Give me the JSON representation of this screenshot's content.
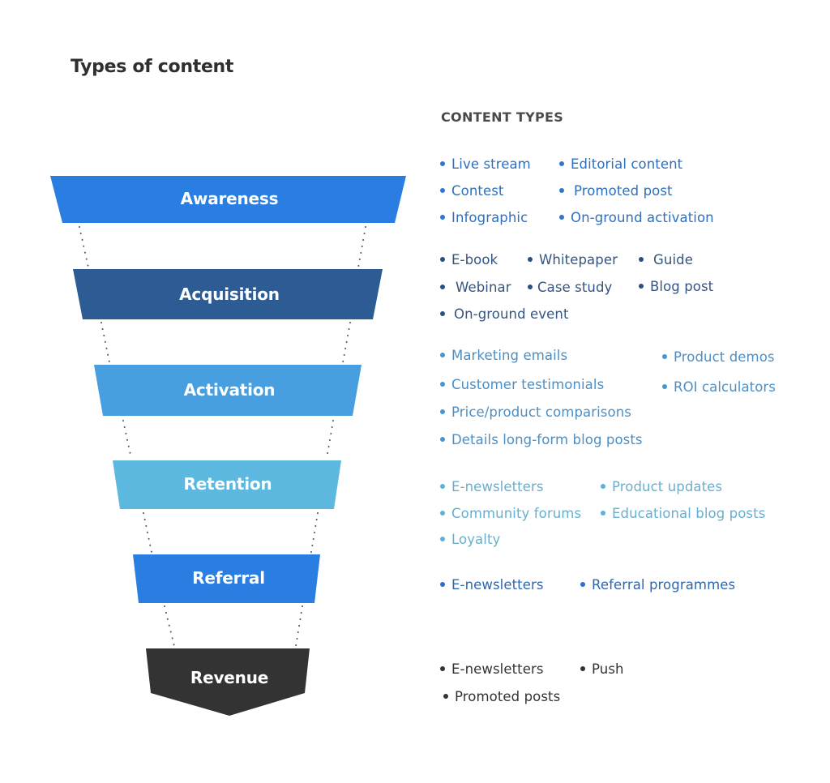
{
  "title": "Types of content",
  "section_heading": "CONTENT TYPES",
  "colors": {
    "awareness": "#2a7de1",
    "acquisition": "#2d5b94",
    "activation": "#479fdf",
    "retention": "#5cb8de",
    "referral": "#2a7de1",
    "revenue": "#333333",
    "connector": "#4a5a70"
  },
  "stages": [
    {
      "label": "Awareness",
      "items": [
        "Live stream",
        "Contest",
        "Infographic",
        "Editorial content",
        "Promoted post",
        "On-ground activation"
      ]
    },
    {
      "label": "Acquisition",
      "items": [
        "E-book",
        "Webinar",
        "On-ground event",
        "Whitepaper",
        "Case study",
        "Guide",
        "Blog post"
      ]
    },
    {
      "label": "Activation",
      "items": [
        "Marketing emails",
        "Customer testimonials",
        "Price/product comparisons",
        "Details long-form blog posts",
        "Product demos",
        "ROI calculators"
      ]
    },
    {
      "label": "Retention",
      "items": [
        "E-newsletters",
        "Community forums",
        "Loyalty",
        "Product updates",
        "Educational blog posts"
      ]
    },
    {
      "label": "Referral",
      "items": [
        "E-newsletters",
        "Referral programmes"
      ]
    },
    {
      "label": "Revenue",
      "items": [
        "E-newsletters",
        "Promoted posts",
        "Push"
      ]
    }
  ]
}
